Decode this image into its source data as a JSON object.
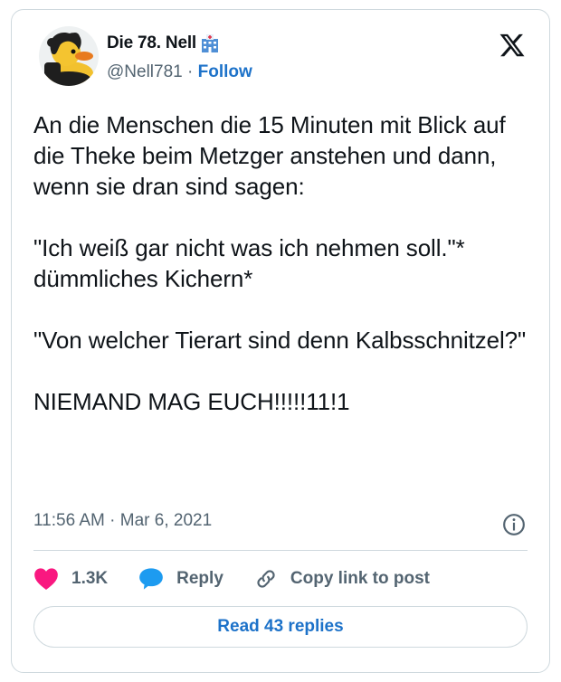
{
  "author": {
    "display_name": "Die 78. Nell",
    "handle": "@Nell781",
    "separator": " · ",
    "follow_label": "Follow"
  },
  "tweet": {
    "text": "An die Menschen die 15 Minuten mit Blick auf die Theke beim Metzger anstehen und dann, wenn sie dran sind sagen:\n\n\"Ich weiß gar nicht was ich nehmen soll.\"* dümmliches Kichern*\n\n\"Von welcher Tierart sind denn Kalbsschnitzel?\"\n\nNIEMAND MAG EUCH!!!!!11!1",
    "timestamp": "11:56 AM · Mar 6, 2021"
  },
  "actions": {
    "like_count": "1.3K",
    "reply_label": "Reply",
    "copy_label": "Copy link to post"
  },
  "read_replies_label": "Read 43 replies",
  "icons": {
    "verified_badge": "hospital-building-icon",
    "logo": "x-logo-icon",
    "info": "info-icon",
    "like": "heart-icon",
    "reply": "speech-bubble-icon",
    "copy": "link-icon"
  },
  "colors": {
    "like": "#f91880",
    "reply": "#1d9bf0",
    "link": "#1d72c9",
    "muted": "#536471"
  }
}
